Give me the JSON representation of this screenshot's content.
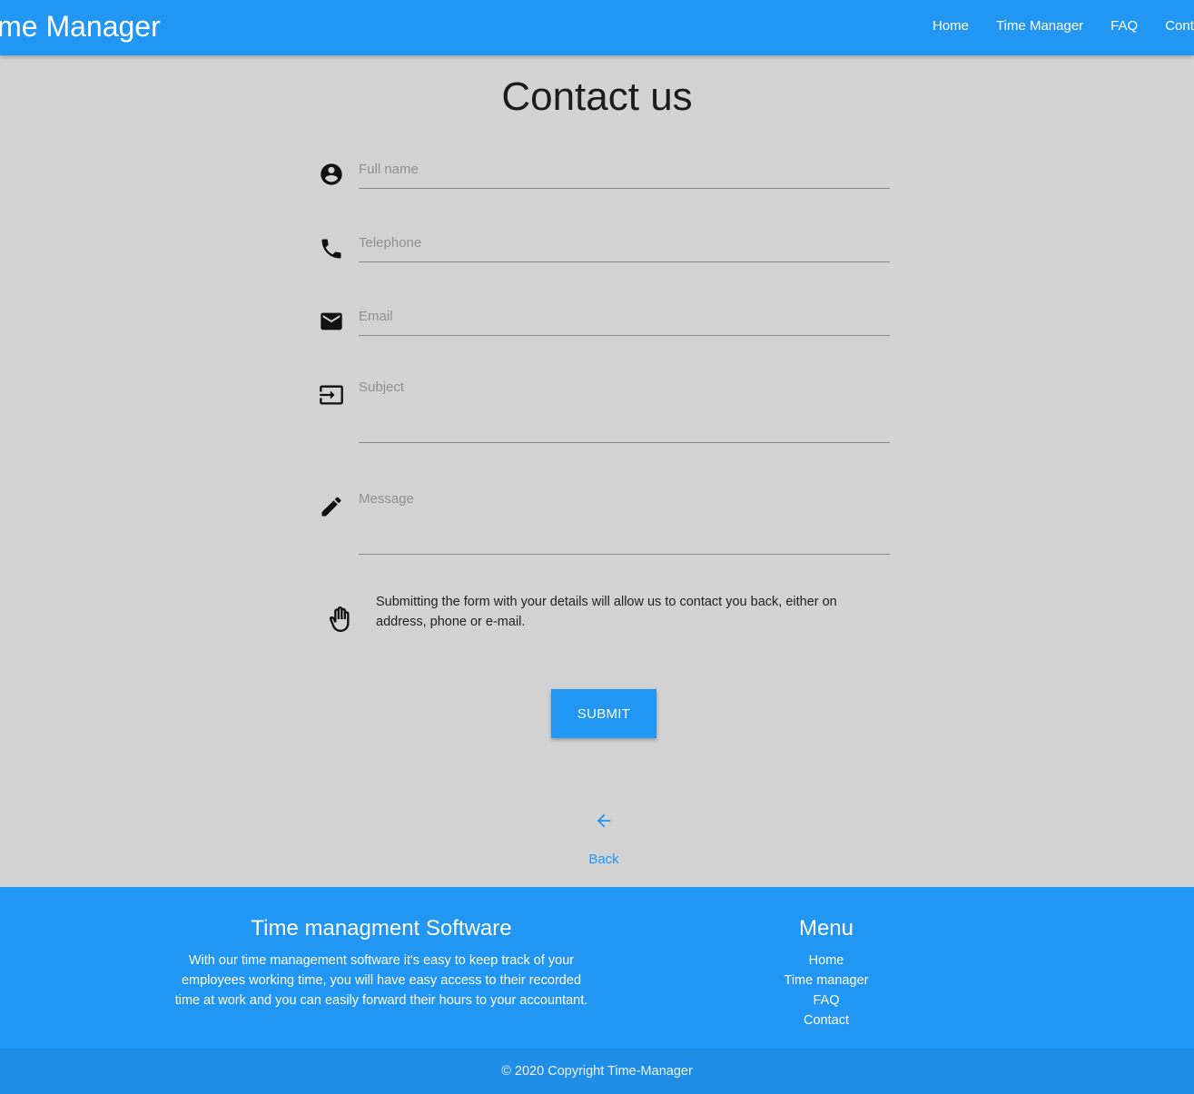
{
  "navbar": {
    "brand": "ime Manager",
    "links": [
      "Home",
      "Time Manager",
      "FAQ",
      "Conta"
    ]
  },
  "page": {
    "title": "Contact us"
  },
  "form": {
    "full_name_placeholder": "Full name",
    "telephone_placeholder": "Telephone",
    "email_placeholder": "Email",
    "subject_placeholder": "Subject",
    "message_placeholder": "Message",
    "notice": "Submitting the form with your details will allow us to contact you back, either on address, phone or e-mail.",
    "submit_label": "SUBMIT",
    "back_label": "Back"
  },
  "icons": {
    "full_name": "account-circle-icon",
    "telephone": "phone-icon",
    "email": "mail-icon",
    "subject": "input-icon",
    "message": "pencil-icon",
    "notice": "hand-icon",
    "back": "arrow-left-icon"
  },
  "footer": {
    "about_title": "Time managment Software",
    "about_text": "With our time management software it's easy to keep track of your employees working time, you will have easy access to their recorded time at work and you can easily forward their hours to your accountant.",
    "menu_title": "Menu",
    "menu_items": [
      "Home",
      "Time manager",
      "FAQ",
      "Contact"
    ],
    "copyright": "© 2020 Copyright Time-Manager"
  },
  "colors": {
    "primary": "#2196f3",
    "background": "#d3d3d3",
    "copyright_bar": "#1f8ee6"
  }
}
